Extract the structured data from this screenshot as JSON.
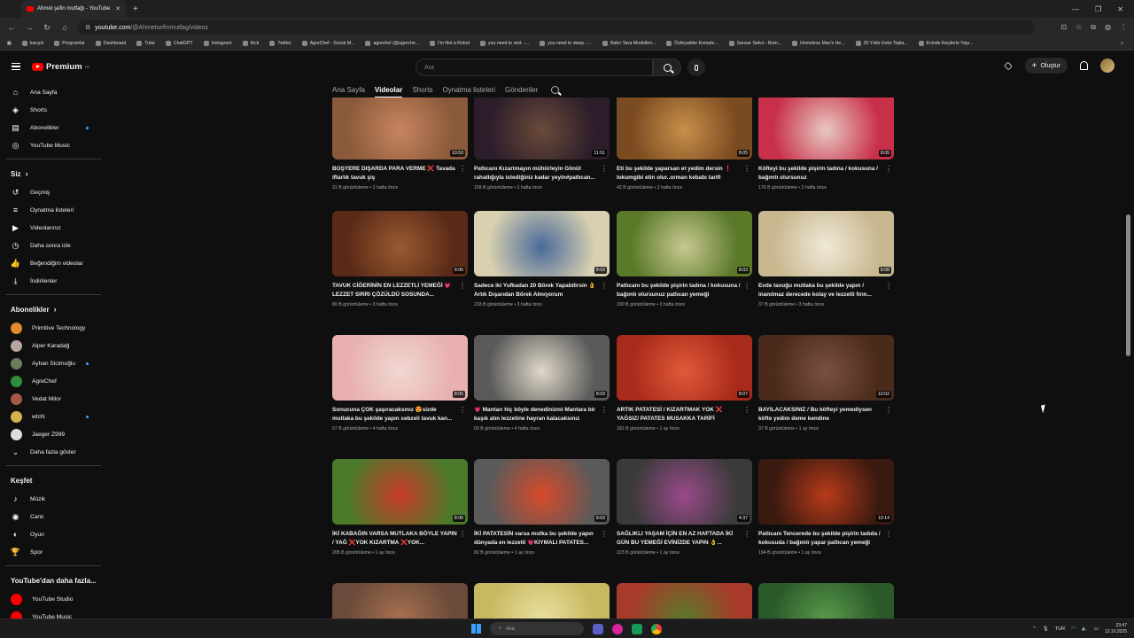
{
  "browser": {
    "tab_title": "Ahmet şefin mutfağı - YouTube",
    "new_tab_symbol": "+",
    "url_host": "youtube.com",
    "url_path": "/@Ahmetsefinmutfag/videos",
    "bookmarks": [
      "karışık",
      "Programlar",
      "Dashboard",
      "Tube",
      "ChatGPT",
      "Instagram",
      "Kick",
      "Twitter",
      "AgreChef - Social M...",
      "agrechef (@agreche...",
      "I'm Not a Robot",
      "you need to rest. -...",
      "you need to sleep. -...",
      "Bakır Tava Modelleri...",
      "Öztiryakiler Komple...",
      "Sansar Salvo - Bom...",
      "Homeless Man's He...",
      "20 Yıldır Evini Topla...",
      "Evinde Keçilerle Yaşı..."
    ],
    "bookmarks_more": "»"
  },
  "header": {
    "logo_text": "Premium",
    "logo_sup": "TR",
    "search_placeholder": "Ara",
    "create_label": "Oluştur"
  },
  "sidebar": {
    "main": [
      {
        "label": "Ana Sayfa",
        "icon": "home-icon",
        "glyph": "⌂"
      },
      {
        "label": "Shorts",
        "icon": "shorts-icon",
        "glyph": "◈"
      },
      {
        "label": "Abonelikler",
        "icon": "subscriptions-icon",
        "glyph": "▤"
      },
      {
        "label": "YouTube Music",
        "icon": "music-icon",
        "glyph": "◎"
      }
    ],
    "you_heading": "Siz",
    "you": [
      {
        "label": "Geçmiş",
        "icon": "history-icon",
        "glyph": "↺"
      },
      {
        "label": "Oynatma listeleri",
        "icon": "playlists-icon",
        "glyph": "≡"
      },
      {
        "label": "Videolarınız",
        "icon": "your-videos-icon",
        "glyph": "▶"
      },
      {
        "label": "Daha sonra izle",
        "icon": "watch-later-icon",
        "glyph": "◷"
      },
      {
        "label": "Beğendiğim videolar",
        "icon": "liked-icon",
        "glyph": "👍"
      },
      {
        "label": "İndirilenler",
        "icon": "downloads-icon",
        "glyph": "⤓"
      }
    ],
    "subs_heading": "Abonelikler",
    "subs": [
      {
        "label": "Primitive Technology",
        "color": "#e08a2b"
      },
      {
        "label": "Alper Karadağ",
        "color": "#b9a6a0"
      },
      {
        "label": "Ayhan Sicimoğlu",
        "color": "#6a7c5c"
      },
      {
        "label": "AgreChef",
        "color": "#2f8c3a"
      },
      {
        "label": "Vedat Milor",
        "color": "#a35a48"
      },
      {
        "label": "wtcN",
        "color": "#d6b34a"
      },
      {
        "label": "Jaeger Z999",
        "color": "#dddddd"
      }
    ],
    "show_more": "Daha fazla göster",
    "explore_heading": "Keşfet",
    "explore": [
      {
        "label": "Müzik",
        "icon": "music-note-icon",
        "glyph": "♪"
      },
      {
        "label": "Canlı",
        "icon": "live-icon",
        "glyph": "◉"
      },
      {
        "label": "Oyun",
        "icon": "gaming-icon",
        "glyph": "◐"
      },
      {
        "label": "Spor",
        "icon": "sports-icon",
        "glyph": "🏆"
      }
    ],
    "more_heading": "YouTube'dan daha fazla...",
    "more": [
      {
        "label": "YouTube Studio",
        "color": "#ff0000"
      },
      {
        "label": "YouTube Music",
        "color": "#ff0000"
      }
    ]
  },
  "channel_tabs": [
    "Ana Sayfa",
    "Videolar",
    "Shorts",
    "Oynatma listeleri",
    "Gönderiler"
  ],
  "active_tab": "Videolar",
  "videos": [
    {
      "title": "BOŞYERE DIŞARDA PARA VERME ❌ Tavada iftarlık tavuk şiş",
      "meta": "31 B görüntüleme • 2 hafta önce",
      "dur": "10:53",
      "c1": "#8a5a3a",
      "c2": "#c98560"
    },
    {
      "title": "Patlıcanı Kızartmayın mühürleyin Gönül rahatlığıyla istediğiniz kadar yeyin#patlıcan...",
      "meta": "158 B görüntüleme • 2 hafta önce",
      "dur": "11:51",
      "c1": "#2b1d2a",
      "c2": "#6a4a3a"
    },
    {
      "title": "Eti bu şekilde yaparsan et yedim dersin ❗ lokumgibi etin olur..orman kebabı tarifi",
      "meta": "42 B görüntüleme • 2 hafta önce",
      "dur": "8:05",
      "c1": "#7a4a20",
      "c2": "#c9904a"
    },
    {
      "title": "Köfteyi bu şekilde pişirin tadına / kokusuna / bağımlı olursunuz",
      "meta": "176 B görüntüleme • 2 hafta önce",
      "dur": "8:05",
      "c1": "#c8304a",
      "c2": "#e8c8c0"
    },
    {
      "title": "TAVUK CİĞERİNİN EN LEZZETLİ YEMEĞİ 💗LEZZET SIRRI ÇÖZÜLDÜ SOSUNDA...",
      "meta": "80 B görüntüleme • 3 hafta önce",
      "dur": "8:06",
      "c1": "#5a2a18",
      "c2": "#9a5a30"
    },
    {
      "title": "Sadece iki Yufkadan 20 Börek Yapabilirsin 👌 Artık Dışarıdan Börek Almıyorum",
      "meta": "218 B görüntüleme • 3 hafta önce",
      "dur": "8:03",
      "c1": "#d8d0b0",
      "c2": "#4a6a9a"
    },
    {
      "title": "Patlıcanı bu şekilde pişirin tadına / kokusuna / bağımlı olursunuz patlıcan yemeği",
      "meta": "330 B görüntüleme • 3 hafta önce",
      "dur": "8:03",
      "c1": "#5a7a2a",
      "c2": "#c8c890"
    },
    {
      "title": "Evde tavuğu mutlaka bu şekilde yapın / inanılmaz derecede kolay ve lezzetli fırın...",
      "meta": "37 B görüntüleme • 3 hafta önce",
      "dur": "8:08",
      "c1": "#c8b890",
      "c2": "#f0e8d8"
    },
    {
      "title": "Sonucuna ÇOK şaşıracaksınız 😍sizde mutlaka bu şekilde yapın sebzeli tavuk kan...",
      "meta": "57 B görüntüleme • 4 hafta önce",
      "dur": "8:05",
      "c1": "#e8b0b0",
      "c2": "#f0d8d0"
    },
    {
      "title": "💗 Mantarı hiç böyle denedinizmi Mantara bir kaşık atın lezzetine hayran kalacaksınız",
      "meta": "60 B görüntüleme • 4 hafta önce",
      "dur": "8:03",
      "c1": "#5a5a5a",
      "c2": "#e0d8c8"
    },
    {
      "title": "ARTIK PATATESİ / KIZARTMAK YOK ❌ YAĞSIZ/ PATATES MUSAKKA TARİFİ",
      "meta": "181 B görüntüleme • 1 ay önce",
      "dur": "8:07",
      "c1": "#a82a1a",
      "c2": "#e05a3a"
    },
    {
      "title": "BAYILACAKSINIZ / Bu köfteyi yemediysen köfte yedim deme kendine",
      "meta": "37 B görüntüleme • 1 ay önce",
      "dur": "10:02",
      "c1": "#4a2a1a",
      "c2": "#7a5040"
    },
    {
      "title": "İKİ KABAĞIN VARSA MUTLAKA BÖYLE YAPIN / YAĞ ❌YOK KIZARTMA ❌YOK...",
      "meta": "205 B görüntüleme • 1 ay önce",
      "dur": "8:06",
      "c1": "#4a7a2a",
      "c2": "#c83a2a"
    },
    {
      "title": "İKİ PATATESİN varsa mutka bu şekilde yapın dünyada en lezzetli 💗KIYMALI PATATES...",
      "meta": "82 B görüntüleme • 1 ay önce",
      "dur": "8:03",
      "c1": "#5a5a5a",
      "c2": "#d84a2a"
    },
    {
      "title": "SAĞLIKLI YAŞAM İÇİN EN AZ HAFTADA İKİ GÜN BU YEMEĞİ EVİNİZDE YAPIN 👌...",
      "meta": "223 B görüntüleme • 1 ay önce",
      "dur": "4:37",
      "c1": "#3a3a3a",
      "c2": "#9a4a8a"
    },
    {
      "title": "Patlıcanı Tencerede bu şekilde pişirin tadıda / kokusuda / bağımlı yapar patlıcan yemeği",
      "meta": "194 B görüntüleme • 1 ay önce",
      "dur": "10:14",
      "c1": "#3a1a10",
      "c2": "#b83a1a"
    },
    {
      "title": "",
      "meta": "",
      "dur": "",
      "c1": "#6a4a3a",
      "c2": "#a87050"
    },
    {
      "title": "",
      "meta": "",
      "dur": "",
      "c1": "#c8b860",
      "c2": "#e8e0a0"
    },
    {
      "title": "",
      "meta": "",
      "dur": "",
      "c1": "#a83a2a",
      "c2": "#5a7a2a"
    },
    {
      "title": "",
      "meta": "",
      "dur": "",
      "c1": "#2a5a2a",
      "c2": "#5a9a4a"
    }
  ],
  "taskbar": {
    "search_placeholder": "Ara",
    "lang": "TUR",
    "time": "23:47",
    "date": "13.10.2025"
  }
}
